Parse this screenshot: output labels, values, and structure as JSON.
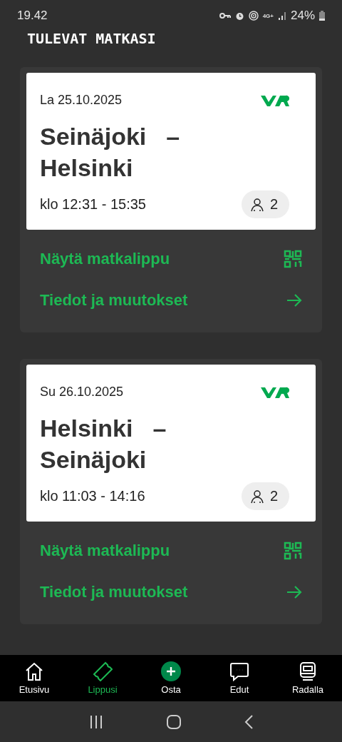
{
  "status_bar": {
    "time": "19.42",
    "battery": "24%",
    "network": "4G+"
  },
  "heading": "TULEVAT MATKASI",
  "trips": [
    {
      "date": "La 25.10.2025",
      "from": "Seinäjoki",
      "separator": "–",
      "to": "Helsinki",
      "time": "klo 12:31 - 15:35",
      "passengers": "2",
      "actions": [
        {
          "kind": "qr",
          "label": "Näytä matkalippu"
        },
        {
          "kind": "arrow",
          "label": "Tiedot ja muutokset"
        }
      ]
    },
    {
      "date": "Su 26.10.2025",
      "from": "Helsinki",
      "separator": "–",
      "to": "Seinäjoki",
      "time": "klo 11:03 - 14:16",
      "passengers": "2",
      "actions": [
        {
          "kind": "qr",
          "label": "Näytä matkalippu"
        },
        {
          "kind": "arrow",
          "label": "Tiedot ja muutokset"
        }
      ]
    }
  ],
  "nav": [
    {
      "kind": "home",
      "label": "Etusivu",
      "selected": false
    },
    {
      "kind": "ticket",
      "label": "Lippusi",
      "selected": true
    },
    {
      "kind": "plus",
      "label": "Osta",
      "selected": false
    },
    {
      "kind": "chat",
      "label": "Edut",
      "selected": false
    },
    {
      "kind": "train",
      "label": "Radalla",
      "selected": false
    }
  ]
}
